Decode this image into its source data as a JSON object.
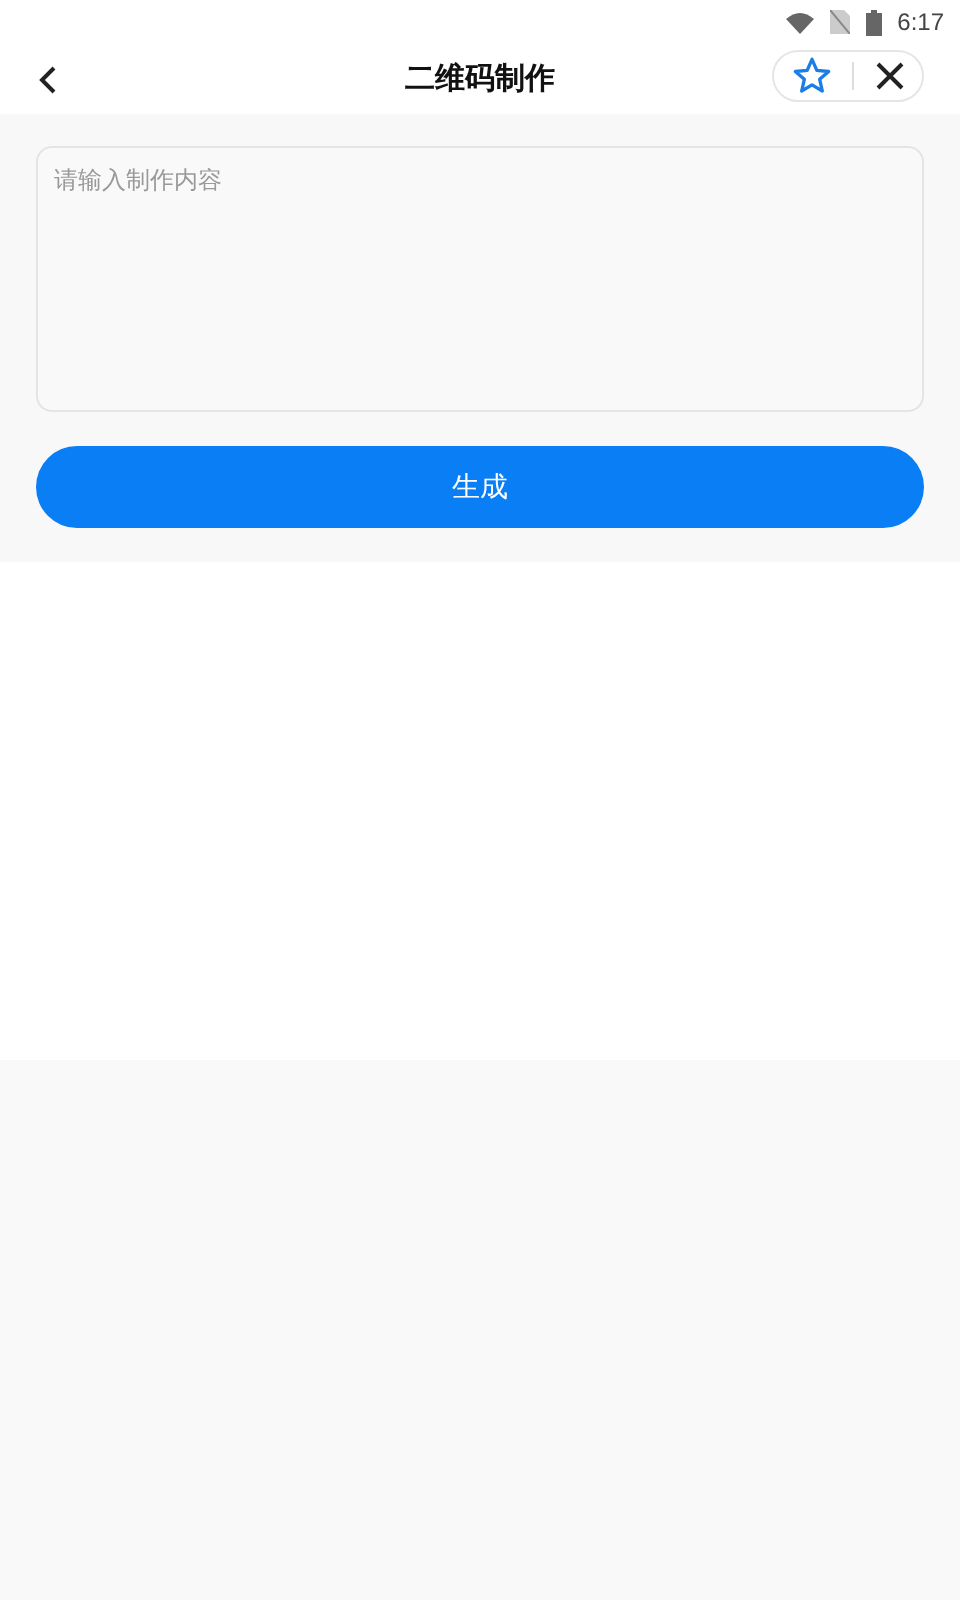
{
  "status_bar": {
    "time": "6:17"
  },
  "header": {
    "title": "二维码制作"
  },
  "input": {
    "placeholder": "请输入制作内容"
  },
  "generate_button": {
    "label": "生成"
  }
}
